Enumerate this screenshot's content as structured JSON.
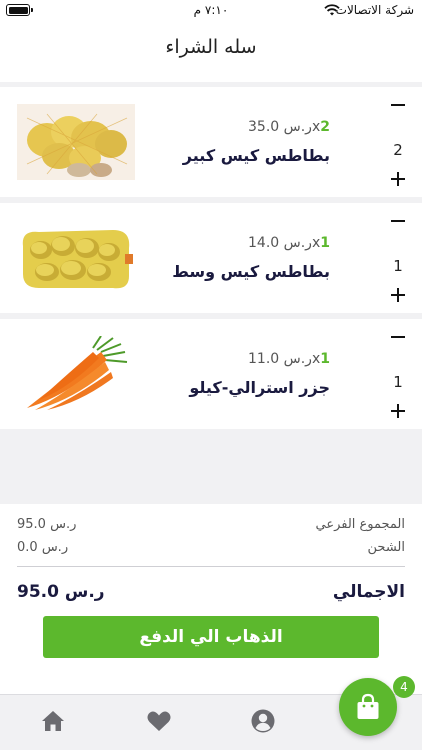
{
  "status_bar": {
    "carrier": "شركة الاتصالات",
    "time": "٧:١٠ م"
  },
  "header": {
    "title": "سله الشراء"
  },
  "items": [
    {
      "name": "بطاطس كيس كبير",
      "unit_price": "35.0",
      "currency": "ر.س",
      "multiplier": "x",
      "count": "2",
      "quantity": "2",
      "image": "potato-sack-image"
    },
    {
      "name": "بطاطس كيس وسط",
      "unit_price": "14.0",
      "currency": "ر.س",
      "multiplier": "x",
      "count": "1",
      "quantity": "1",
      "image": "potato-sack-image"
    },
    {
      "name": "جزر استرالي-كيلو",
      "unit_price": "11.0",
      "currency": "ر.س",
      "multiplier": "x",
      "count": "1",
      "quantity": "1",
      "image": "carrot-image"
    }
  ],
  "summary": {
    "subtotal_label": "المجموع الفرعي",
    "subtotal_value": "95.0 ر.س",
    "shipping_label": "الشحن",
    "shipping_value": "0.0 ر.س",
    "total_label": "الاجمالي",
    "total_value": "95.0 ر.س",
    "checkout_label": "الذهاب الي الدفع"
  },
  "nav": {
    "items": [
      "home-icon",
      "heart-icon",
      "profile-icon"
    ],
    "cart_icon": "shopping-bag-icon",
    "cart_badge": "4"
  },
  "colors": {
    "accent": "#5cb82d",
    "text_dark": "#1a1a3f",
    "background": "#f1f1f3"
  }
}
